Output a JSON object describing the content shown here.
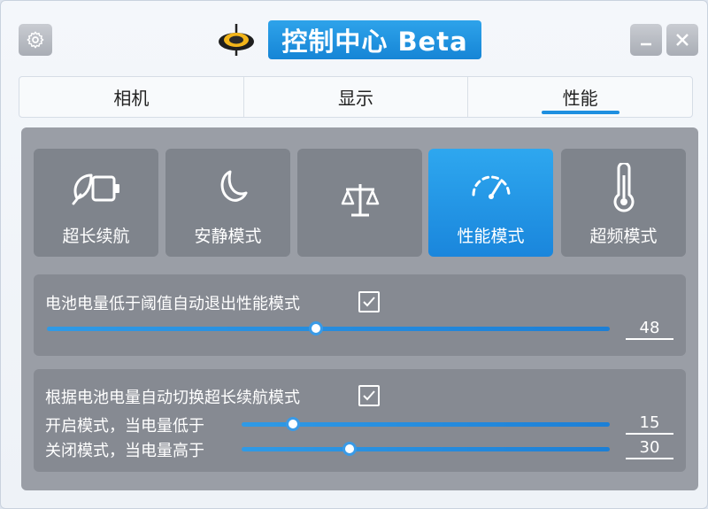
{
  "header": {
    "title": "控制中心 Beta",
    "settings_icon": "gear-icon",
    "logo_icon": "gyroscope-logo",
    "minimize_icon": "minimize-icon",
    "close_icon": "close-icon"
  },
  "tabs": [
    {
      "label": "相机",
      "active": false
    },
    {
      "label": "显示",
      "active": false
    },
    {
      "label": "性能",
      "active": true
    }
  ],
  "modes": [
    {
      "label": "超长续航",
      "icon": "battery-leaf-icon",
      "active": false
    },
    {
      "label": "安静模式",
      "icon": "moon-icon",
      "active": false
    },
    {
      "label": "",
      "icon": "balance-scale-icon",
      "active": false
    },
    {
      "label": "性能模式",
      "icon": "speedometer-icon",
      "active": true
    },
    {
      "label": "超频模式",
      "icon": "thermometer-icon",
      "active": false
    }
  ],
  "battery_exit": {
    "label": "电池电量低于阈值自动退出性能模式",
    "checked": true,
    "value": "48",
    "fraction": 0.48
  },
  "auto_switch": {
    "label": "根据电池电量自动切换超长续航模式",
    "checked": true,
    "on_label": "开启模式，当电量低于",
    "on_value": "15",
    "on_fraction": 0.15,
    "off_label": "关闭模式，当电量高于",
    "off_value": "30",
    "off_fraction": 0.3
  },
  "colors": {
    "accent": "#1e8fe0",
    "panel": "#9a9ea6",
    "card": "#7f848c"
  }
}
